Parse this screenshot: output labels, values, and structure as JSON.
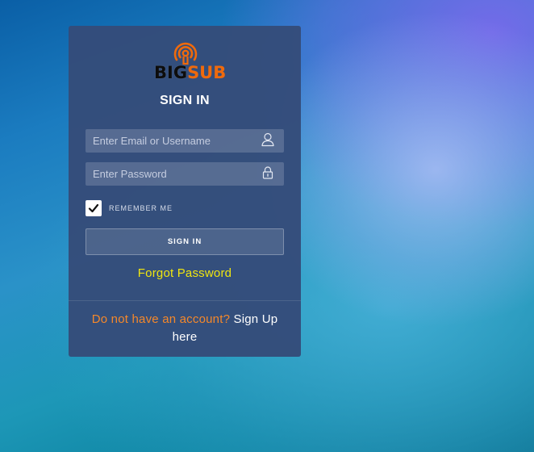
{
  "logo": {
    "text_part1": "BIG",
    "text_part2": "SUB",
    "icon": "broadcast-signal-icon",
    "colors": {
      "dark": "#0d0d0d",
      "orange": "#ef6a0c"
    }
  },
  "form": {
    "title": "SIGN IN",
    "email": {
      "placeholder": "Enter Email or Username",
      "value": "",
      "icon": "user-icon"
    },
    "password": {
      "placeholder": "Enter Password",
      "value": "",
      "icon": "lock-icon"
    },
    "remember": {
      "label": "REMEMBER ME",
      "checked": true
    },
    "submit_label": "SIGN IN",
    "forgot_label": "Forgot Password"
  },
  "signup": {
    "prompt": "Do not have an account?",
    "link_label": "Sign Up here"
  },
  "colors": {
    "card": "#354c7a",
    "forgot": "#f0e60f",
    "signup_prompt": "#f5882a"
  }
}
